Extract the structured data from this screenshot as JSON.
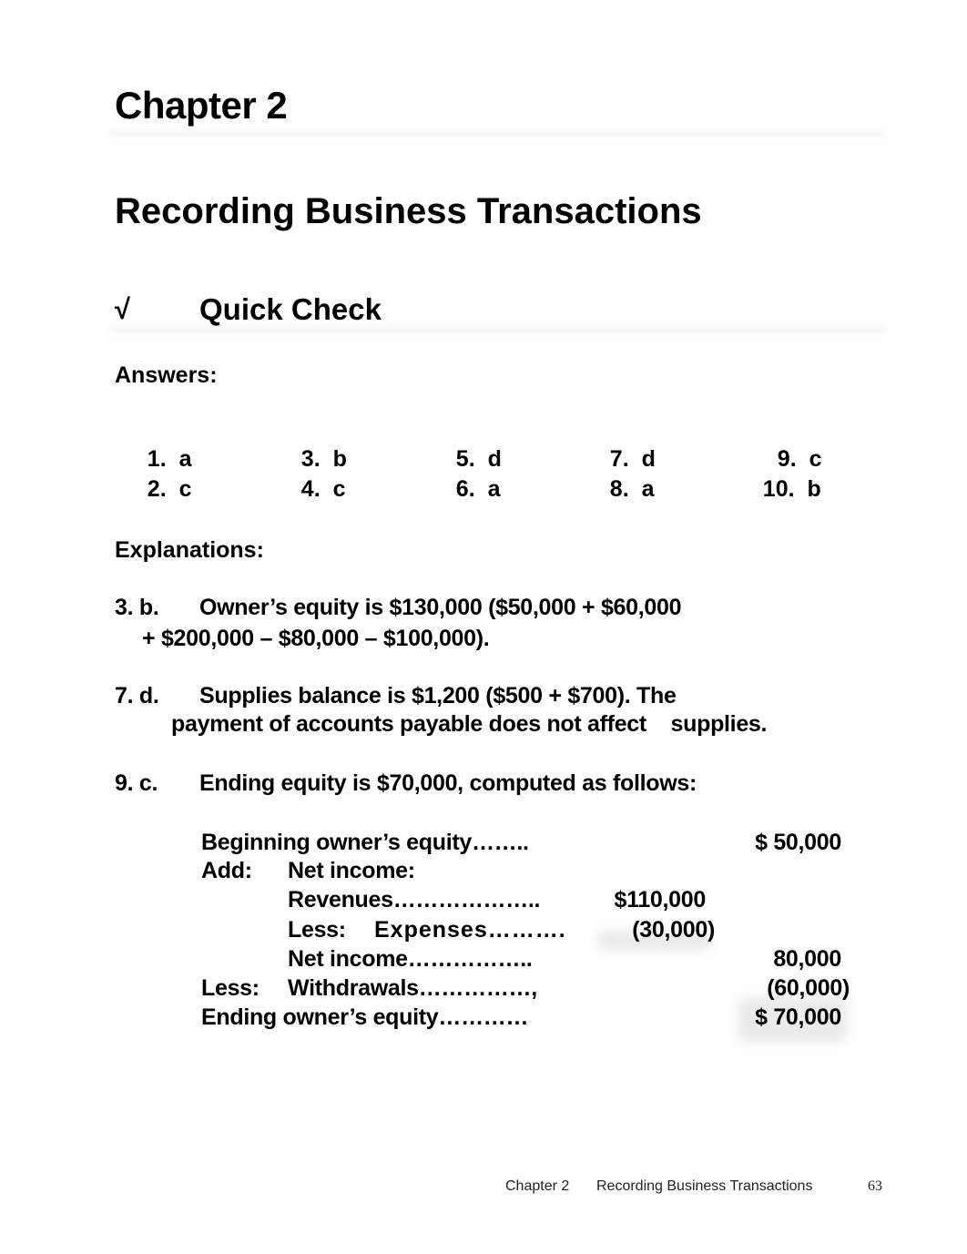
{
  "chapter_heading": "Chapter 2",
  "chapter_title": "Recording Business Transactions",
  "section": {
    "icon": "√",
    "title": "Quick Check"
  },
  "answers": {
    "label": "Answers:",
    "items": [
      {
        "num": "1.",
        "letter": "a"
      },
      {
        "num": "2.",
        "letter": "c"
      },
      {
        "num": "3.",
        "letter": "b"
      },
      {
        "num": "4.",
        "letter": "c"
      },
      {
        "num": "5.",
        "letter": "d"
      },
      {
        "num": "6.",
        "letter": "a"
      },
      {
        "num": "7.",
        "letter": "d"
      },
      {
        "num": "8.",
        "letter": "a"
      },
      {
        "num": "9.",
        "letter": "c"
      },
      {
        "num": "10.",
        "letter": "b"
      }
    ]
  },
  "explanations": {
    "label": "Explanations:",
    "items": [
      {
        "key": "3. b.",
        "line1": "Owner’s equity is $130,000 ($50,000 + $60,000",
        "line2": "+ $200,000 – $80,000 – $100,000)."
      },
      {
        "key": "7. d.",
        "line1": "Supplies balance is $1,200 ($500 + $700). The",
        "line2": "payment of accounts payable does not affect    supplies."
      },
      {
        "key": "9. c.",
        "line1": "Ending equity is $70,000, computed as follows:"
      }
    ]
  },
  "computation": {
    "rows": [
      {
        "label": "Beginning owner’s equity……..",
        "col2": "",
        "col3": "$ 50,000"
      },
      {
        "prefix": "Add:",
        "label": "Net income:",
        "col2": "",
        "col3": ""
      },
      {
        "label": "Revenues………………..",
        "col2": "$110,000",
        "col3": ""
      },
      {
        "prefix": "Less:",
        "label": "Expenses……….",
        "col2": "(30,000)",
        "col3": ""
      },
      {
        "label": "Net income……………..",
        "col2": "",
        "col3": "80,000"
      },
      {
        "prefix": "Less:",
        "label": "Withdrawals……………,",
        "col2": "",
        "col3": "(60,000)"
      },
      {
        "label": "Ending owner’s equity…………",
        "col2": "",
        "col3": "$ 70,000"
      }
    ]
  },
  "footer": {
    "chapter": "Chapter 2",
    "title": "Recording Business Transactions",
    "page": "63"
  }
}
